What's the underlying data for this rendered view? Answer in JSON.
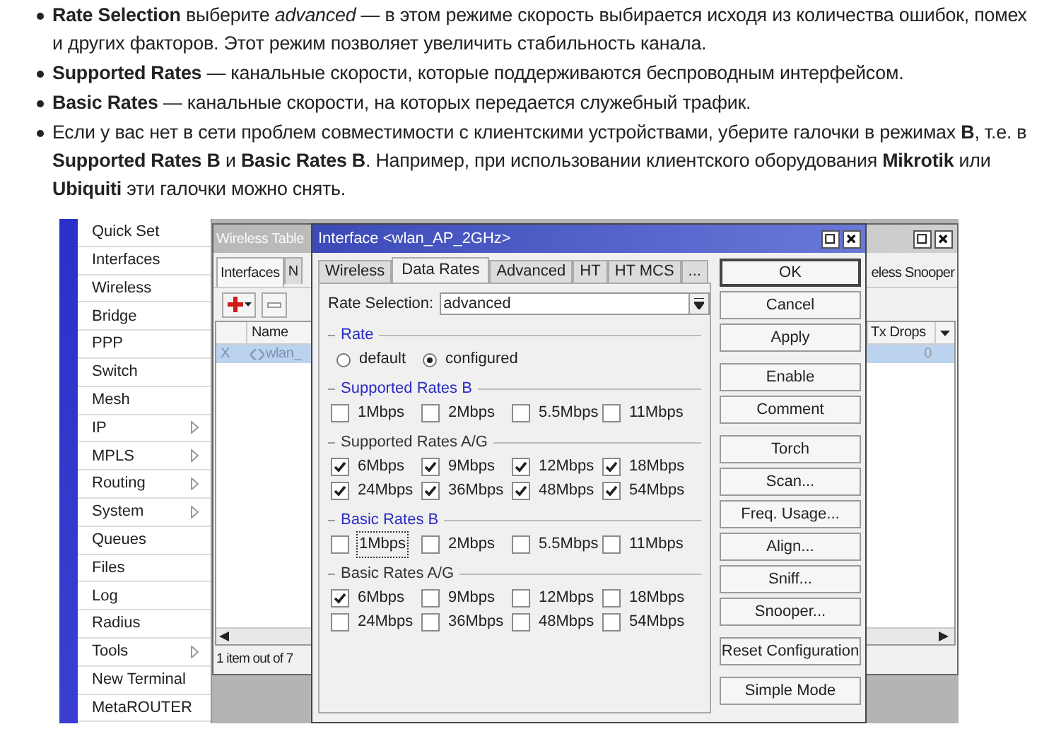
{
  "article": {
    "bullets": [
      "**Rate Selection** выберите *advanced* — в этом режиме скорость выбирается исходя из количества ошибок, помех и других факторов. Этот режим позволяет увеличить стабильность канала.",
      "**Supported Rates** — канальные скорости, которые поддерживаются беспроводным интерфейсом.",
      "**Basic Rates** — канальные скорости, на которых передается служебный трафик.",
      "Если у вас нет в сети проблем совместимости с клиентскими устройствами, уберите галочки в режимах **B**, т.е. в **Supported Rates B** и **Basic Rates B**. Например, при использовании клиентского оборудования **Mikrotik** или **Ubiquiti** эти галочки можно снять."
    ]
  },
  "winbox": {
    "menu": [
      {
        "label": "Quick Set",
        "submenu": false
      },
      {
        "label": "Interfaces",
        "submenu": false
      },
      {
        "label": "Wireless",
        "submenu": false
      },
      {
        "label": "Bridge",
        "submenu": false
      },
      {
        "label": "PPP",
        "submenu": false
      },
      {
        "label": "Switch",
        "submenu": false
      },
      {
        "label": "Mesh",
        "submenu": false
      },
      {
        "label": "IP",
        "submenu": true
      },
      {
        "label": "MPLS",
        "submenu": true
      },
      {
        "label": "Routing",
        "submenu": true
      },
      {
        "label": "System",
        "submenu": true
      },
      {
        "label": "Queues",
        "submenu": false
      },
      {
        "label": "Files",
        "submenu": false
      },
      {
        "label": "Log",
        "submenu": false
      },
      {
        "label": "Radius",
        "submenu": false
      },
      {
        "label": "Tools",
        "submenu": true
      },
      {
        "label": "New Terminal",
        "submenu": false
      },
      {
        "label": "MetaROUTER",
        "submenu": false
      }
    ],
    "wireless_tables": {
      "title": "Wireless Table",
      "tabs": [
        {
          "label": "Interfaces",
          "selected": true
        },
        {
          "label": "N",
          "selected": false
        }
      ],
      "tab_right": "eless Snooper",
      "columns": [
        "Name",
        "Tx Drops"
      ],
      "rows": [
        {
          "column_1": "X",
          "name": "wlan_",
          "tx_drops": "0",
          "selected": true
        }
      ],
      "status": "1 item out of 7"
    },
    "dialog": {
      "title": "Interface <wlan_AP_2GHz>",
      "tabs": [
        {
          "label": "Wireless",
          "selected": false
        },
        {
          "label": "Data Rates",
          "selected": true
        },
        {
          "label": "Advanced",
          "selected": false
        },
        {
          "label": "HT",
          "selected": false
        },
        {
          "label": "HT MCS",
          "selected": false
        },
        {
          "label": "...",
          "selected": false
        }
      ],
      "rate_selection": {
        "label": "Rate Selection:",
        "value": "advanced"
      },
      "rate": {
        "title": "Rate",
        "color": "#2b2bc4",
        "options": [
          {
            "label": "default",
            "selected": false
          },
          {
            "label": "configured",
            "selected": true
          }
        ]
      },
      "groups": [
        {
          "title": "Supported Rates B",
          "color": "#2b2bc4",
          "options": [
            {
              "label": "1Mbps",
              "checked": false,
              "focused": false
            },
            {
              "label": "2Mbps",
              "checked": false,
              "focused": false
            },
            {
              "label": "5.5Mbps",
              "checked": false,
              "focused": false
            },
            {
              "label": "11Mbps",
              "checked": false,
              "focused": false
            }
          ]
        },
        {
          "title": "Supported Rates A/G",
          "color": "#333333",
          "options": [
            {
              "label": "6Mbps",
              "checked": true,
              "focused": false
            },
            {
              "label": "9Mbps",
              "checked": true,
              "focused": false
            },
            {
              "label": "12Mbps",
              "checked": true,
              "focused": false
            },
            {
              "label": "18Mbps",
              "checked": true,
              "focused": false
            },
            {
              "label": "24Mbps",
              "checked": true,
              "focused": false
            },
            {
              "label": "36Mbps",
              "checked": true,
              "focused": false
            },
            {
              "label": "48Mbps",
              "checked": true,
              "focused": false
            },
            {
              "label": "54Mbps",
              "checked": true,
              "focused": false
            }
          ]
        },
        {
          "title": "Basic Rates B",
          "color": "#2b2bc4",
          "options": [
            {
              "label": "1Mbps",
              "checked": false,
              "focused": true
            },
            {
              "label": "2Mbps",
              "checked": false,
              "focused": false
            },
            {
              "label": "5.5Mbps",
              "checked": false,
              "focused": false
            },
            {
              "label": "11Mbps",
              "checked": false,
              "focused": false
            }
          ]
        },
        {
          "title": "Basic Rates A/G",
          "color": "#333333",
          "options": [
            {
              "label": "6Mbps",
              "checked": true,
              "focused": false
            },
            {
              "label": "9Mbps",
              "checked": false,
              "focused": false
            },
            {
              "label": "12Mbps",
              "checked": false,
              "focused": false
            },
            {
              "label": "18Mbps",
              "checked": false,
              "focused": false
            },
            {
              "label": "24Mbps",
              "checked": false,
              "focused": false
            },
            {
              "label": "36Mbps",
              "checked": false,
              "focused": false
            },
            {
              "label": "48Mbps",
              "checked": false,
              "focused": false
            },
            {
              "label": "54Mbps",
              "checked": false,
              "focused": false
            }
          ]
        }
      ],
      "buttons": [
        [
          {
            "label": "OK",
            "default": true
          },
          {
            "label": "Cancel",
            "default": false
          },
          {
            "label": "Apply",
            "default": false
          }
        ],
        [
          {
            "label": "Enable",
            "default": false
          },
          {
            "label": "Comment",
            "default": false
          }
        ],
        [
          {
            "label": "Torch",
            "default": false
          },
          {
            "label": "Scan...",
            "default": false
          },
          {
            "label": "Freq. Usage...",
            "default": false
          },
          {
            "label": "Align...",
            "default": false
          },
          {
            "label": "Sniff...",
            "default": false
          },
          {
            "label": "Snooper...",
            "default": false
          }
        ],
        [
          {
            "label": "Reset Configuration",
            "default": false
          }
        ],
        [
          {
            "label": "Simple Mode",
            "default": false
          }
        ]
      ]
    }
  }
}
